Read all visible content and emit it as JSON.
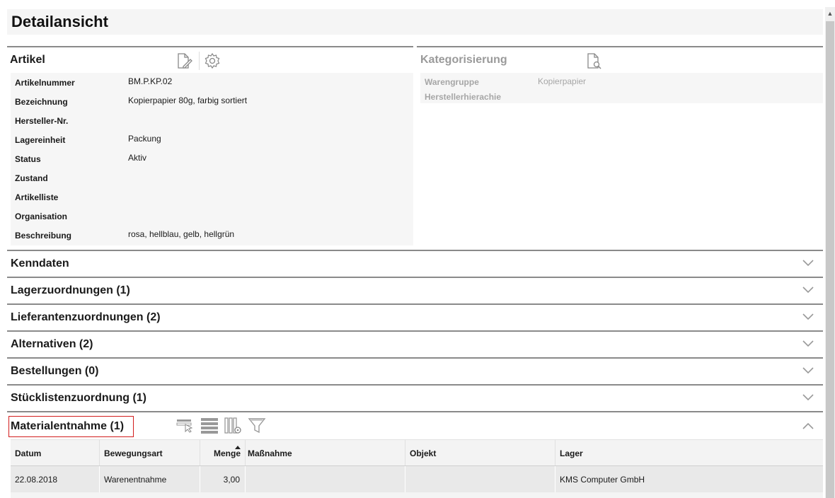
{
  "page": {
    "title": "Detailansicht"
  },
  "artikel": {
    "title": "Artikel",
    "icons": [
      "edit-document-icon",
      "gear-icon"
    ],
    "fields": [
      {
        "label": "Artikelnummer",
        "value": "BM.P.KP.02"
      },
      {
        "label": "Bezeichnung",
        "value": "Kopierpapier 80g, farbig sortiert"
      },
      {
        "label": "Hersteller-Nr.",
        "value": ""
      },
      {
        "label": "Lagereinheit",
        "value": "Packung"
      },
      {
        "label": "Status",
        "value": "Aktiv"
      },
      {
        "label": "Zustand",
        "value": ""
      },
      {
        "label": "Artikelliste",
        "value": ""
      },
      {
        "label": "Organisation",
        "value": ""
      },
      {
        "label": "Beschreibung",
        "value": "rosa, hellblau, gelb, hellgrün"
      }
    ]
  },
  "kategorisierung": {
    "title": "Kategorisierung",
    "icons": [
      "search-document-icon"
    ],
    "fields": [
      {
        "label": "Warengruppe",
        "value": "Kopierpapier"
      },
      {
        "label": "Herstellerhierachie",
        "value": ""
      }
    ]
  },
  "sections": [
    {
      "title": "Kenndaten",
      "state": "collapsed"
    },
    {
      "title": "Lagerzuordnungen (1)",
      "state": "collapsed"
    },
    {
      "title": "Lieferantenzuordnungen (2)",
      "state": "collapsed"
    },
    {
      "title": "Alternativen (2)",
      "state": "collapsed"
    },
    {
      "title": "Bestellungen (0)",
      "state": "collapsed"
    },
    {
      "title": "Stücklistenzuordnung (1)",
      "state": "collapsed"
    }
  ],
  "materialentnahme": {
    "title": "Materialentnahme (1)",
    "state": "expanded",
    "icons": [
      "select-row-icon",
      "rows-icon",
      "column-settings-icon",
      "filter-icon"
    ],
    "columns": [
      "Datum",
      "Bewegungsart",
      "Menge",
      "Maßnahme",
      "Objekt",
      "Lager"
    ],
    "sorted_column": "Menge",
    "rows": [
      [
        "22.08.2018",
        "Warenentnahme",
        "3,00",
        "",
        "",
        "KMS Computer GmbH"
      ]
    ]
  },
  "colors": {
    "divider": "#8a8a8a",
    "highlight_border": "#d21c1c",
    "muted_text": "#9a9a9a"
  }
}
